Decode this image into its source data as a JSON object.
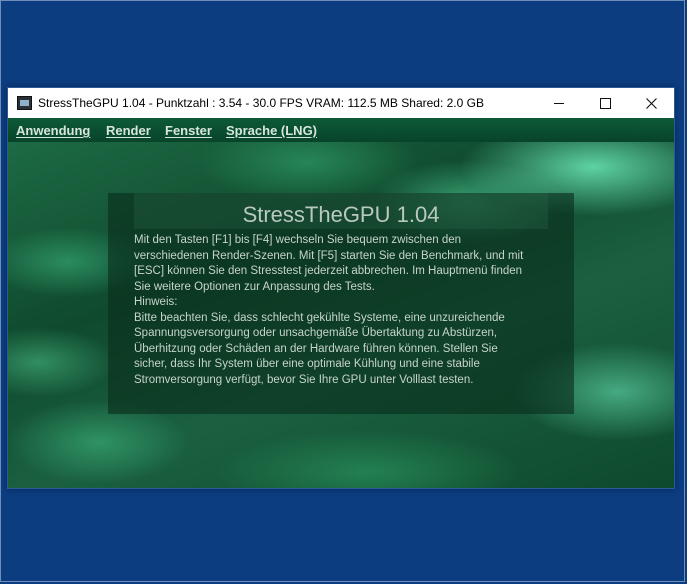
{
  "window": {
    "title": "StressTheGPU 1.04 - Punktzahl : 3.54 - 30.0 FPS   VRAM: 112.5 MB Shared: 2.0 GB",
    "controls": {
      "minimize": "minimize",
      "maximize": "maximize",
      "close": "close"
    }
  },
  "menu": {
    "items": [
      {
        "label": "Anwendung"
      },
      {
        "label": "Render"
      },
      {
        "label": "Fenster"
      },
      {
        "label": "Sprache (LNG)"
      }
    ]
  },
  "overlay": {
    "title": "StressTheGPU 1.04",
    "lines": [
      "Mit den Tasten [F1] bis [F4] wechseln Sie bequem zwischen den",
      "verschiedenen Render-Szenen. Mit [F5] starten Sie den Benchmark, und mit",
      "[ESC] können Sie den Stresstest jederzeit abbrechen. Im Hauptmenü finden",
      "Sie weitere Optionen zur Anpassung des Tests.",
      "Hinweis:",
      "Bitte beachten Sie, dass schlecht gekühlte Systeme, eine unzureichende",
      "Spannungsversorgung oder unsachgemäße Übertaktung zu Abstürzen,",
      "Überhitzung oder Schäden an der Hardware führen können. Stellen Sie",
      "sicher, dass Ihr System über eine optimale Kühlung und eine stabile",
      "Stromversorgung verfügt, bevor Sie Ihre GPU unter Volllast testen."
    ]
  },
  "colors": {
    "desktop": "#0b3d80",
    "menubar": "#0a4a2e",
    "overlay_text": "#c6d4ca"
  },
  "icons": {
    "app": "app-icon",
    "minimize": "minimize-icon",
    "maximize": "maximize-icon",
    "close": "close-icon"
  }
}
